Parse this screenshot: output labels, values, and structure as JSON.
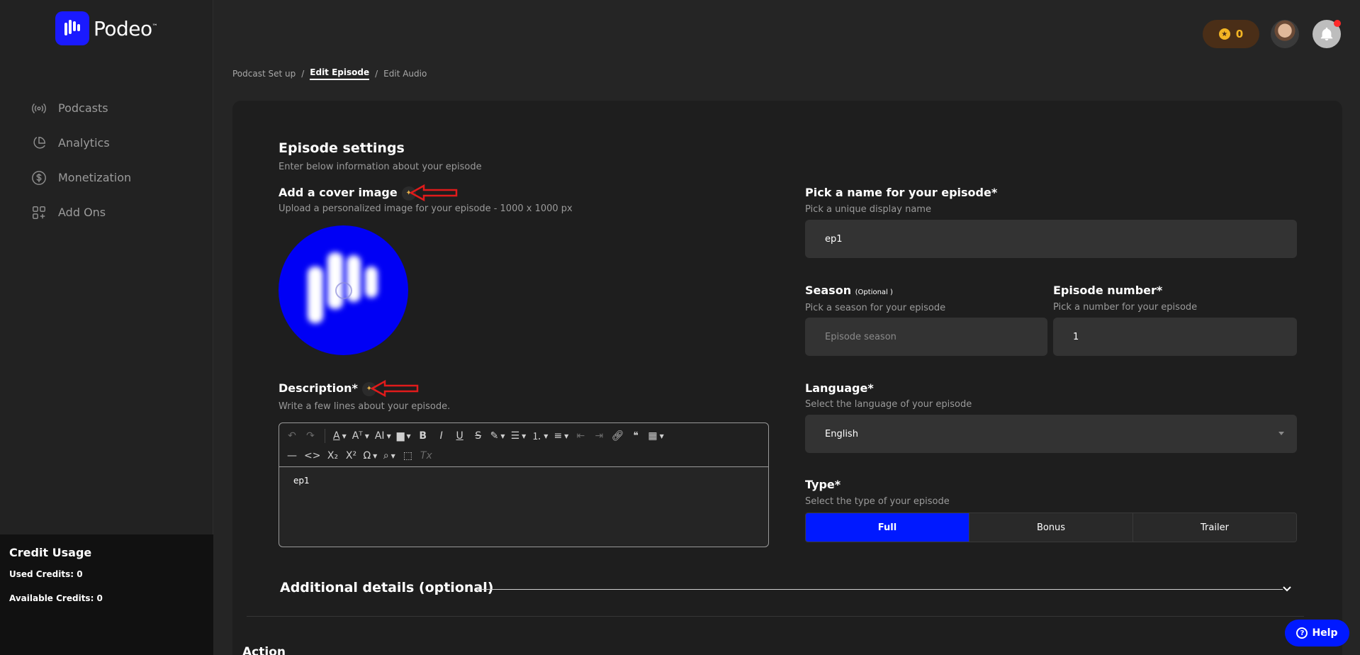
{
  "brand": {
    "name": "Podeo",
    "tm": "™",
    "color": "#1a1aff"
  },
  "sidebar": {
    "items": [
      {
        "label": "Podcasts",
        "icon": "broadcast-icon"
      },
      {
        "label": "Analytics",
        "icon": "pie-chart-icon"
      },
      {
        "label": "Monetization",
        "icon": "dollar-icon"
      },
      {
        "label": "Add Ons",
        "icon": "add-grid-icon"
      }
    ],
    "credit": {
      "title": "Credit Usage",
      "used": "Used Credits: 0",
      "available": "Available Credits: 0"
    }
  },
  "header": {
    "coins": "0",
    "notification_dot_color": "#ff2a2a"
  },
  "breadcrumb": {
    "items": [
      "Podcast Set up",
      "Edit Episode",
      "Edit Audio"
    ],
    "separator": "/"
  },
  "settings": {
    "title": "Episode settings",
    "subtitle": "Enter below information about your episode",
    "cover": {
      "label": "Add a cover image",
      "hint": "Upload a personalized image for your episode - 1000 x 1000 px"
    },
    "description": {
      "label": "Description*",
      "hint": "Write a few lines about your episode.",
      "value": "ep1"
    },
    "name": {
      "label": "Pick a name for your episode*",
      "hint": "Pick a unique display name",
      "value": "ep1"
    },
    "season": {
      "label": "Season",
      "optional": "(Optional )",
      "hint": "Pick a season for your episode",
      "placeholder": "Episode season"
    },
    "episode_number": {
      "label": "Episode number*",
      "hint": "Pick a number for your episode",
      "value": "1"
    },
    "language": {
      "label": "Language*",
      "hint": "Select the language of your episode",
      "value": "English"
    },
    "type": {
      "label": "Type*",
      "hint": "Select the type of your episode",
      "options": [
        "Full",
        "Bonus",
        "Trailer"
      ],
      "selected": "Full"
    },
    "additional": "Additional details (optional)",
    "action": "Action"
  },
  "help": {
    "label": "Help"
  },
  "colors": {
    "accent": "#0019ff",
    "coin": "#f3b524",
    "arrow": "#e01b1b"
  }
}
